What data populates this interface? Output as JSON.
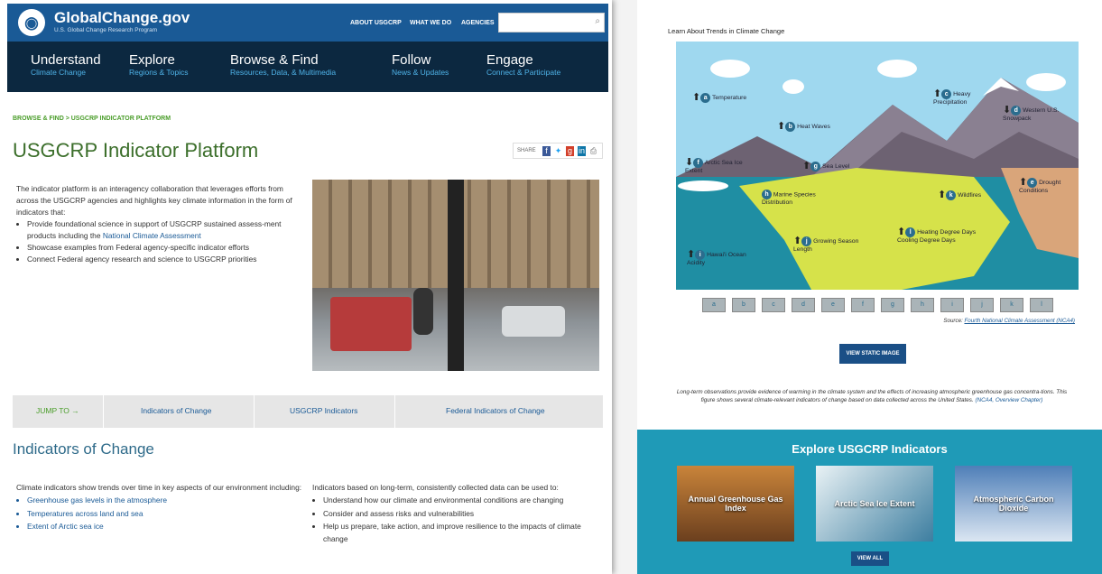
{
  "header": {
    "logo_text": "GlobalChange.gov",
    "logo_sub": "U.S. Global Change Research Program",
    "top_links": [
      "ABOUT USGCRP",
      "WHAT WE DO",
      "AGENCIES"
    ],
    "search_placeholder": ""
  },
  "main_nav": [
    {
      "title": "Understand",
      "sub": "Climate Change"
    },
    {
      "title": "Explore",
      "sub": "Regions & Topics"
    },
    {
      "title": "Browse & Find",
      "sub": "Resources, Data, & Multimedia"
    },
    {
      "title": "Follow",
      "sub": "News & Updates"
    },
    {
      "title": "Engage",
      "sub": "Connect & Participate"
    }
  ],
  "breadcrumb": "BROWSE & FIND  >  USGCRP INDICATOR PLATFORM",
  "page_title": "USGCRP Indicator Platform",
  "share_label": "SHARE",
  "intro": {
    "text": "The indicator platform is an interagency collaboration that leverages efforts from across the USGCRP agencies and highlights key climate information in the form of indicators that:",
    "bullets": [
      "Provide foundational science in support of USGCRP sustained assess-ment products including the",
      "Showcase examples from Federal agency-specific indicator efforts",
      "Connect Federal agency research and science to USGCRP priorities"
    ],
    "nca_link": "National Climate Assessment"
  },
  "jump": {
    "label": "JUMP TO →",
    "items": [
      "Indicators of Change",
      "USGCRP Indicators",
      "Federal Indicators of Change"
    ]
  },
  "indicators_section": {
    "title": "Indicators of Change",
    "col1_text": "Climate indicators show trends over time in key aspects of our environment including:",
    "col1_links": [
      "Greenhouse gas levels in the atmosphere",
      "Temperatures across land and sea",
      "Extent of Arctic sea ice"
    ],
    "col2_text": "Indicators based on long-term, consistently collected data can be used to:",
    "col2_bullets": [
      "Understand how our climate and environmental conditions are changing",
      "Consider and assess risks and vulnerabilities",
      "Help us prepare, take action, and improve resilience to the impacts of climate change"
    ]
  },
  "right": {
    "heading": "Learn About Trends in Climate Change",
    "labels": {
      "a": "Temperature",
      "b": "Heat Waves",
      "c": "Heavy Precipitation",
      "d": "Western U.S. Snowpack",
      "e": "Drought Conditions",
      "f": "Arctic Sea Ice Extent",
      "g": "Sea Level",
      "h": "Marine Species Distribution",
      "i": "Hawai'i Ocean Acidity",
      "j": "Growing Season Length",
      "k": "Wildfires",
      "l": "Heating Degree Days Cooling Degree Days"
    },
    "thumbs": [
      "a",
      "b",
      "c",
      "d",
      "e",
      "f",
      "g",
      "h",
      "i",
      "j",
      "k",
      "l"
    ],
    "source_prefix": "Source: ",
    "source_link": "Fourth National Climate Assessment (NCA4)",
    "static_button": "VIEW STATIC IMAGE",
    "caption": "Long-term observations provide evidence of warming in the climate system and the effects of increasing atmospheric greenhouse gas concentra-tions. This figure shows several climate-relevant indicators of change based on data collected across the United States.",
    "caption_link": "(NCA4, Overview Chapter)",
    "explore_title": "Explore USGCRP Indicators",
    "cards": [
      "Annual Greenhouse Gas Index",
      "Arctic Sea Ice Extent",
      "Atmospheric Carbon Dioxide"
    ],
    "view_all": "VIEW ALL"
  }
}
